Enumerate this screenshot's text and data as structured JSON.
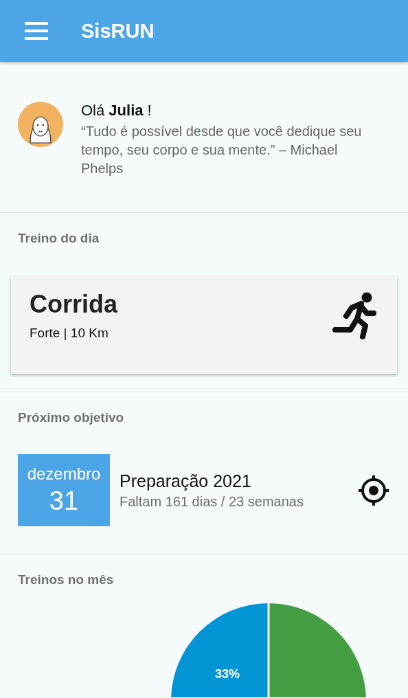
{
  "app_bar": {
    "title": "SisRUN"
  },
  "greeting": {
    "hello": "Olá **Julia** !",
    "quote": "“Tudo é possível desde que você dedique seu tempo, seu corpo e sua mente.” – Michael Phelps"
  },
  "daily_training": {
    "heading": "Treino do dia",
    "title": "Corrida",
    "detail": "Forte | 10 Km"
  },
  "next_goal": {
    "heading": "Próximo objetivo",
    "month": "dezembro",
    "day": "31",
    "title": "Preparação 2021",
    "remaining": "Faltam 161 dias / 23 semanas"
  },
  "monthly_trainings": {
    "heading": "Treinos no mês",
    "slice_label": "33%"
  }
}
